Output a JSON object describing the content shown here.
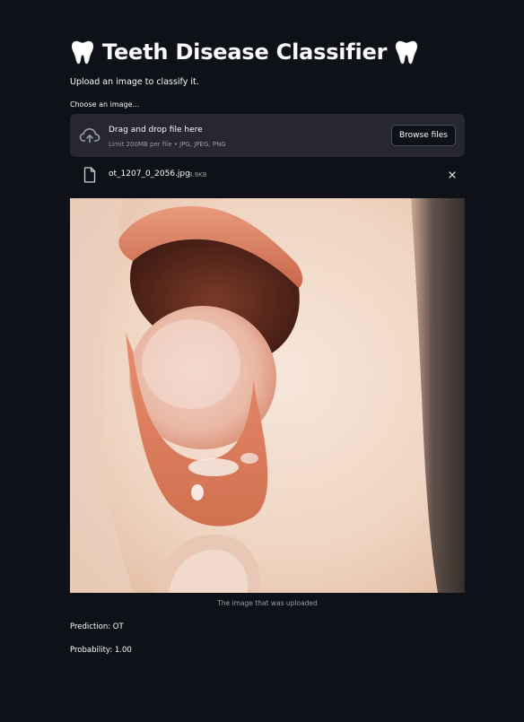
{
  "header": {
    "title": "Teeth Disease Classifier",
    "title_icon": "tooth-icon"
  },
  "intro": {
    "text": "Upload an image to classify it."
  },
  "uploader": {
    "label": "Choose an image...",
    "drop_text": "Drag and drop file here",
    "limit_text": "Limit 200MB per file • JPG, JPEG, PNG",
    "browse_label": "Browse files",
    "upload_icon": "cloud-upload-icon"
  },
  "uploaded_file": {
    "name": "ot_1207_0_2056.jpg",
    "size": "8.9KB",
    "file_icon": "file-icon",
    "remove_icon": "close-icon"
  },
  "image": {
    "caption": "The image that was uploaded"
  },
  "result": {
    "prediction": "Prediction: OT",
    "probability": "Probability: 1.00"
  },
  "colors": {
    "background": "#0e1117",
    "panel": "#262730",
    "text": "#fafafa",
    "muted_text": "#9a9ca3"
  }
}
